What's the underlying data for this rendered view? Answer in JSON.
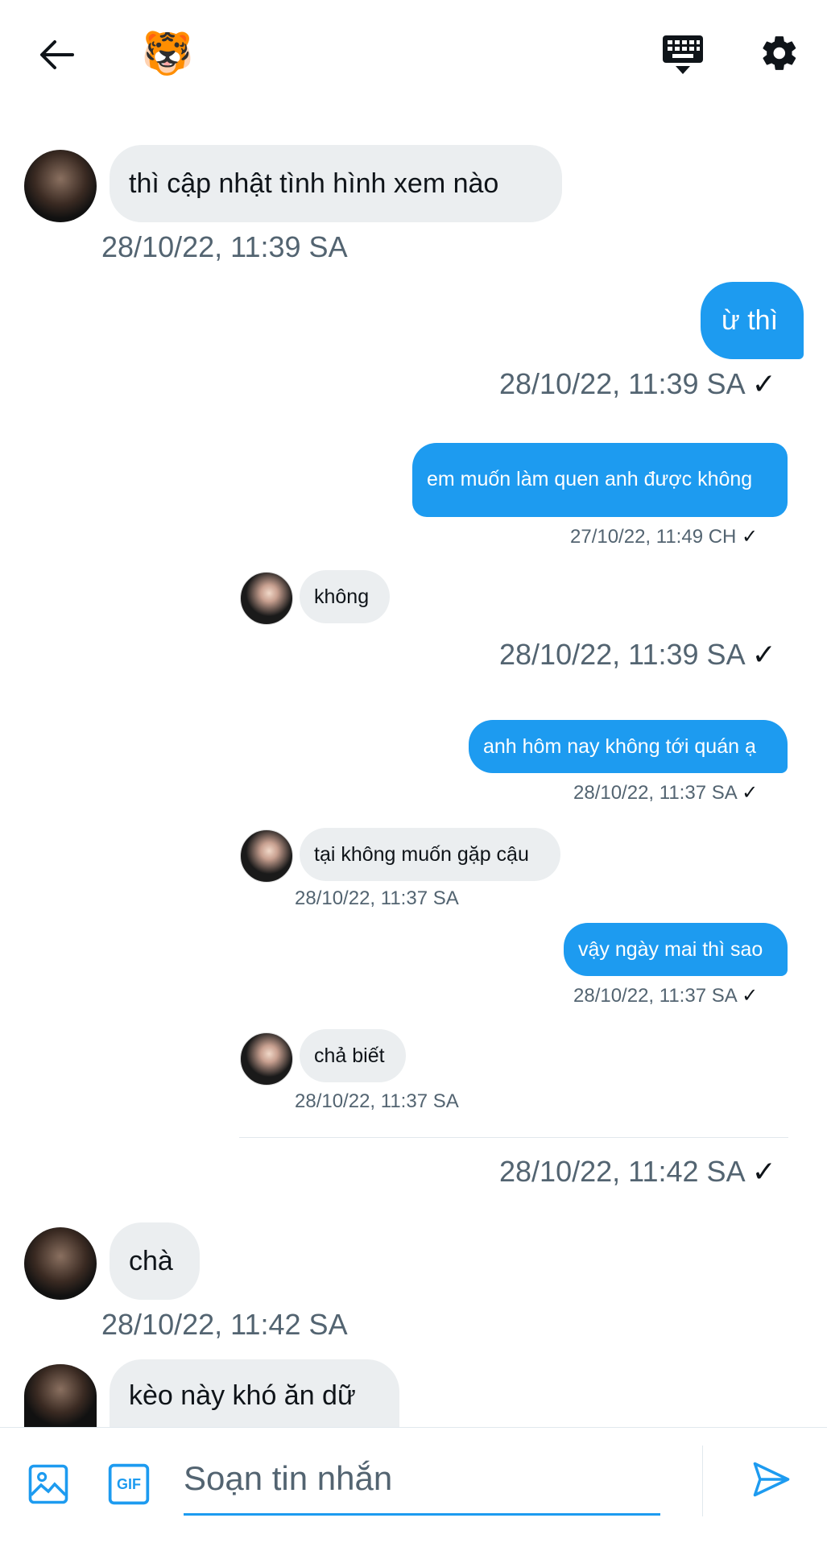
{
  "header": {
    "tiger_avatar": "🐯",
    "back_icon": "back-arrow-icon",
    "keyboard_icon": "keyboard-icon",
    "settings_icon": "gear-icon"
  },
  "messages": [
    {
      "text": "thì cập nhật tình hình xem nào",
      "ts": "28/10/22, 11:39 SA"
    },
    {
      "text": "ừ thì",
      "ts": "28/10/22, 11:39 SA",
      "check": "✓"
    },
    {
      "text": "em muốn làm quen anh được không",
      "ts": "27/10/22, 11:49 CH",
      "check": "✓"
    },
    {
      "text": "không"
    },
    {
      "ts": "28/10/22, 11:39 SA",
      "check": "✓"
    },
    {
      "text": "anh hôm nay không tới quán ạ",
      "ts": "28/10/22, 11:37 SA",
      "check": "✓"
    },
    {
      "text": "tại không muốn gặp cậu",
      "ts": "28/10/22, 11:37 SA"
    },
    {
      "text": "vậy ngày mai thì sao",
      "ts": "28/10/22, 11:37 SA",
      "check": "✓"
    },
    {
      "text": "chả biết",
      "ts": "28/10/22, 11:37 SA"
    },
    {
      "ts": "28/10/22, 11:42 SA",
      "check": "✓"
    },
    {
      "text": "chà",
      "ts": "28/10/22, 11:42 SA"
    },
    {
      "text": "kèo này khó ăn dữ"
    }
  ],
  "composer": {
    "placeholder": "Soạn tin nhắn",
    "gif_label": "GIF"
  },
  "colors": {
    "accent": "#1d9bf0",
    "received_bubble": "#ebeef0",
    "timestamp": "#536471"
  }
}
